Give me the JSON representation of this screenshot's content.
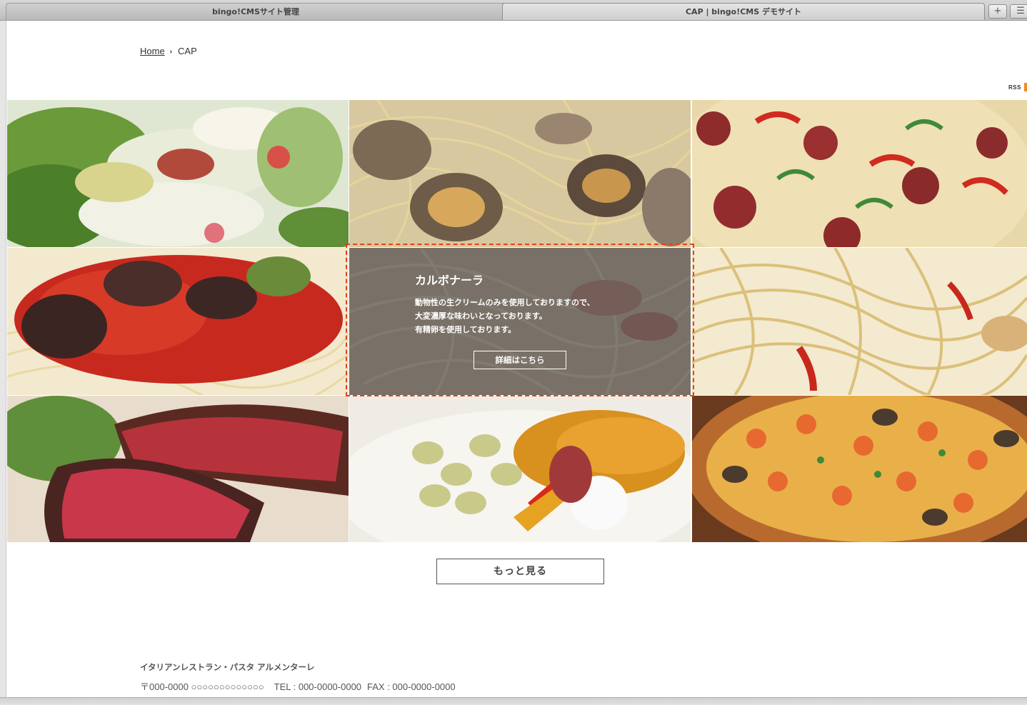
{
  "browser": {
    "tabs": [
      {
        "label": "bingo!CMSサイト管理",
        "active": false
      },
      {
        "label": "CAP | bingo!CMS デモサイト",
        "active": true
      }
    ],
    "new_tab_glyph": "+",
    "tab_list_glyph": "☰"
  },
  "breadcrumb": {
    "home": "Home",
    "separator": "›",
    "current": "CAP"
  },
  "rss": {
    "label": "RSS"
  },
  "gallery": {
    "items": [
      {
        "name": "salad",
        "icon": "salad-photo"
      },
      {
        "name": "clam-pasta",
        "icon": "vongole-photo"
      },
      {
        "name": "salami-pizza",
        "icon": "pizza-photo"
      },
      {
        "name": "eggplant-tomato-pasta",
        "icon": "tomato-pasta-photo"
      },
      {
        "name": "carbonara",
        "icon": "carbonara-photo"
      },
      {
        "name": "peperoncino-pasta",
        "icon": "peperoncino-photo"
      },
      {
        "name": "roast-beef",
        "icon": "roast-beef-photo"
      },
      {
        "name": "vegetable-antipasto",
        "icon": "antipasto-photo"
      },
      {
        "name": "seafood-pizza",
        "icon": "seafood-pizza-photo"
      }
    ],
    "hover": {
      "title": "カルボナーラ",
      "description_lines": [
        "動物性の生クリームのみを使用しておりますので、",
        "大変濃厚な味わいとなっております。",
        "有精卵を使用しております。"
      ],
      "detail_button": "詳細はこちら"
    }
  },
  "more_button": "もっと見る",
  "footer": {
    "name": "イタリアンレストラン・パスタ アルメンターレ",
    "address": "〒000-0000 ○○○○○○○○○○○○○",
    "tel": "TEL : 000-0000-0000",
    "fax": "FAX : 000-0000-0000"
  },
  "colors": {
    "selection_border": "#e8401c",
    "rss_accent": "#f08a24",
    "overlay": "rgba(45,40,40,0.58)"
  }
}
